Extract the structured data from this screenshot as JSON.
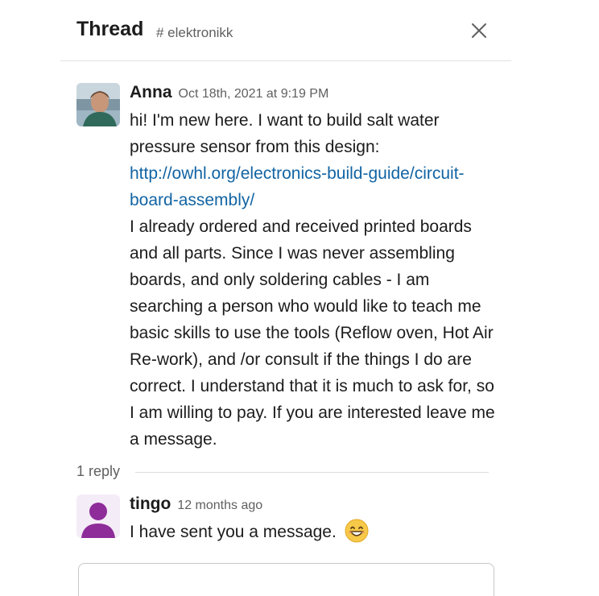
{
  "header": {
    "title": "Thread",
    "channel": "# elektronikk"
  },
  "parent_message": {
    "author": "Anna",
    "timestamp": "Oct 18th, 2021 at 9:19 PM",
    "text_intro": "hi! I'm new here. I want to build  salt water pressure sensor from this design:",
    "link": "http://owhl.org/electronics-build-guide/circuit-board-assembly/",
    "text_body": "I already ordered and received printed boards and all parts.  Since I was never assembling boards, and only soldering cables - I am searching a person who would like to teach me basic skills to use the tools (Reflow oven, Hot Air Re-work), and /or consult if the things I do are correct. I understand that it is much to ask for, so I am willing to pay. If you are interested leave me a message."
  },
  "replies": {
    "count_label": "1 reply",
    "items": [
      {
        "author": "tingo",
        "timestamp": "12 months ago",
        "text": "I have sent you a message.",
        "emoji": "smile-emoji"
      }
    ]
  },
  "colors": {
    "link": "#1264a3",
    "muted": "#616061",
    "text": "#1d1c1d",
    "avatar_default": "#8e2c9a"
  }
}
